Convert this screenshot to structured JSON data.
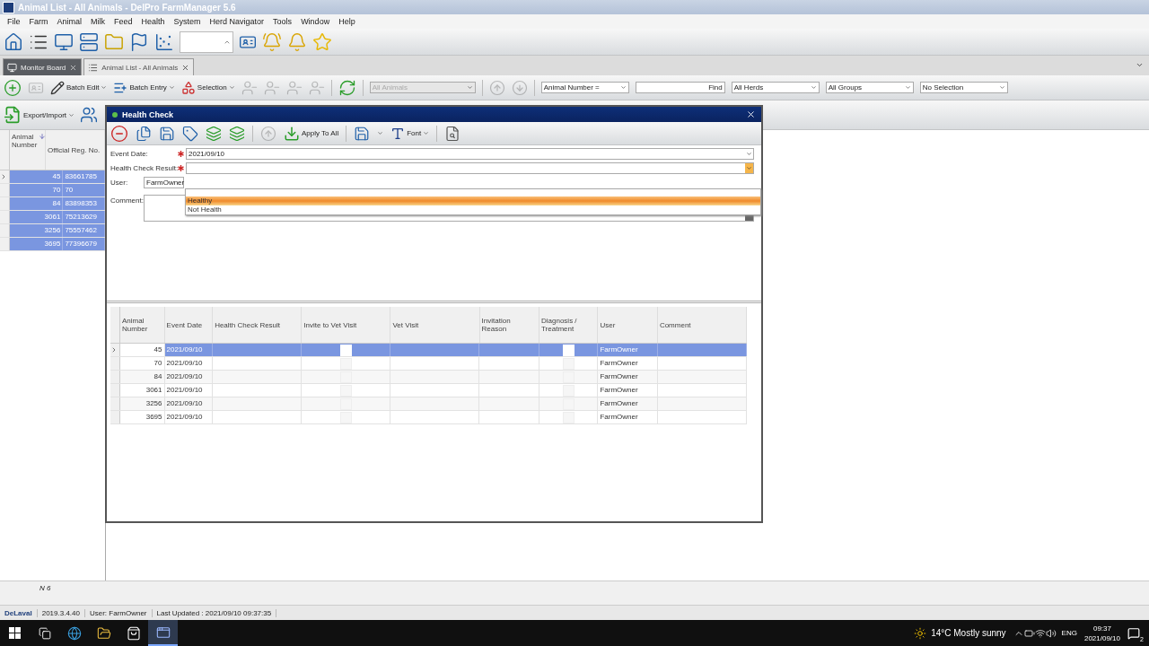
{
  "window": {
    "title": "Animal List - All Animals - DelPro FarmManager 5.6"
  },
  "menu": [
    "File",
    "Farm",
    "Animal",
    "Milk",
    "Feed",
    "Health",
    "System",
    "Herd Navigator",
    "Tools",
    "Window",
    "Help"
  ],
  "tabs": [
    {
      "label": "Monitor Board",
      "selected": false
    },
    {
      "label": "Animal List - All Animals",
      "selected": true
    }
  ],
  "toolbar": {
    "buttons": [
      "Batch Edit",
      "Batch Entry",
      "Selection"
    ],
    "animal_filter": {
      "value": "All Animals",
      "disabled": true
    },
    "search_by": "Animal Number =",
    "find_label": "Find",
    "herd_filter": "All Herds",
    "group_filter": "All Groups",
    "selection_filter": "No Selection",
    "export_button": "Export/Import"
  },
  "animal_list": {
    "columns": [
      "Animal Number",
      "Official Reg. No."
    ],
    "rows": [
      {
        "number": "45",
        "reg_no": "83661785",
        "selected": true
      },
      {
        "number": "70",
        "reg_no": "70",
        "selected": true
      },
      {
        "number": "84",
        "reg_no": "83898353",
        "selected": true
      },
      {
        "number": "3061",
        "reg_no": "75213629",
        "selected": true
      },
      {
        "number": "3256",
        "reg_no": "75557462",
        "selected": true
      },
      {
        "number": "3695",
        "reg_no": "77396679",
        "selected": true
      }
    ]
  },
  "dialog": {
    "title": "Health Check",
    "apply_label": "Apply To All",
    "font_label": "Font",
    "fields": [
      {
        "kind": "dropdown",
        "label": "Event Date:",
        "required": true,
        "value": "2021/09/10",
        "open": false
      },
      {
        "kind": "dropdown",
        "label": "Health Check Result:",
        "required": true,
        "open": true
      },
      {
        "kind": "text",
        "label": "User:",
        "required": false,
        "value": "FarmOwner"
      },
      {
        "kind": "memo",
        "label": "Comment:",
        "required": false
      }
    ],
    "options": [
      {
        "label": "Healthy",
        "selected": true
      },
      {
        "label": "Not Health",
        "selected": false
      }
    ],
    "grid": {
      "columns": [
        "Animal Number",
        "Event Date",
        "Health Check Result",
        "Invite to Vet Visit",
        "Vet Visit",
        "Invitation Reason",
        "Diagnosis / Treatment",
        "User",
        "Comment"
      ],
      "rows": [
        {
          "animal_number": "45",
          "event_date": "2021/09/10",
          "invite_checked": false,
          "diagnosis_checked": false,
          "user": "FarmOwner",
          "selected": true
        },
        {
          "animal_number": "70",
          "event_date": "2021/09/10",
          "invite_checked": false,
          "diagnosis_checked": false,
          "user": "FarmOwner",
          "selected": false
        },
        {
          "animal_number": "84",
          "event_date": "2021/09/10",
          "invite_checked": false,
          "diagnosis_checked": false,
          "user": "FarmOwner",
          "selected": false
        },
        {
          "animal_number": "3061",
          "event_date": "2021/09/10",
          "invite_checked": false,
          "diagnosis_checked": false,
          "user": "FarmOwner",
          "selected": false
        },
        {
          "animal_number": "3256",
          "event_date": "2021/09/10",
          "invite_checked": false,
          "diagnosis_checked": false,
          "user": "FarmOwner",
          "selected": false
        },
        {
          "animal_number": "3695",
          "event_date": "2021/09/10",
          "invite_checked": false,
          "diagnosis_checked": false,
          "user": "FarmOwner",
          "selected": false
        }
      ]
    }
  },
  "footer": {
    "count": "N 6"
  },
  "status_bar": {
    "brand": "DeLaval",
    "version": "2019.3.4.40",
    "user": "User: FarmOwner",
    "last_updated": "Last Updated : 2021/09/10 09:37:35"
  },
  "taskbar": {
    "weather": "14°C Mostly sunny",
    "language": "ENG",
    "time": "09:37",
    "date": "2021/09/10",
    "notifications": "2"
  }
}
